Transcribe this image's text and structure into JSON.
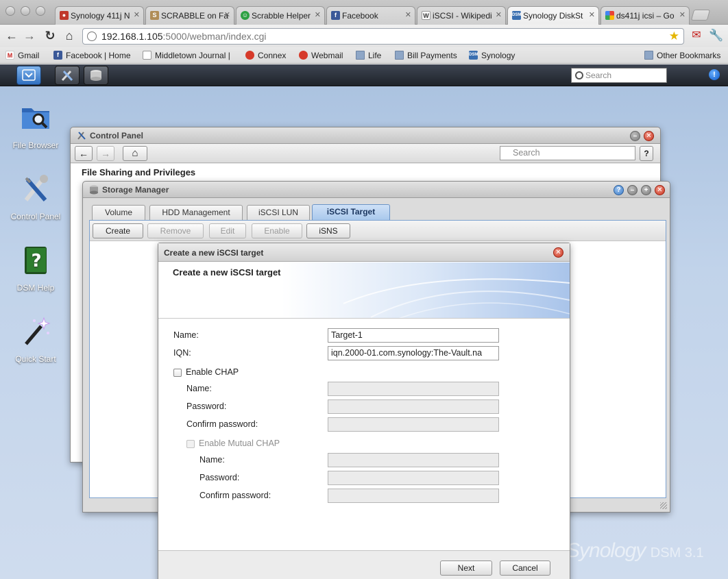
{
  "browser": {
    "tabs": [
      {
        "title": "Synology 411j N",
        "favicon": "apple-icon",
        "color": "#c0392b"
      },
      {
        "title": "SCRABBLE on Fa",
        "favicon": "scrabble-s-icon",
        "color": "#b08d57"
      },
      {
        "title": "Scrabble Helper",
        "favicon": "smiley-icon",
        "color": "#2ea043"
      },
      {
        "title": "Facebook",
        "favicon": "facebook-icon",
        "color": "#3b5998"
      },
      {
        "title": "iSCSI - Wikipedi",
        "favicon": "wikipedia-w-icon",
        "color": "#555555"
      },
      {
        "title": "Synology DiskSt",
        "favicon": "dsm-icon",
        "color": "#3a6fb0"
      },
      {
        "title": "ds411j icsi – Go",
        "favicon": "google-icon",
        "color": "#3b82f6"
      }
    ],
    "url_host": "192.168.1.105",
    "url_rest": ":5000/webman/index.cgi",
    "bookmarks": [
      {
        "label": "Gmail",
        "icon": "gmail-icon"
      },
      {
        "label": "Facebook | Home",
        "icon": "facebook-icon"
      },
      {
        "label": "Middletown Journal |",
        "icon": "page-icon"
      },
      {
        "label": "Connex",
        "icon": "connex-icon"
      },
      {
        "label": "Webmail",
        "icon": "webmail-icon"
      },
      {
        "label": "Life",
        "icon": "folder-icon"
      },
      {
        "label": "Bill Payments",
        "icon": "folder-icon"
      },
      {
        "label": "Synology",
        "icon": "dsm-icon"
      }
    ],
    "other_bookmarks": "Other Bookmarks"
  },
  "dsm": {
    "search_placeholder": "Search",
    "desktop_icons": [
      {
        "label": "File Browser",
        "icon": "file-browser-icon"
      },
      {
        "label": "Control Panel",
        "icon": "control-panel-icon"
      },
      {
        "label": "DSM Help",
        "icon": "help-book-icon"
      },
      {
        "label": "Quick Start",
        "icon": "magic-wand-icon"
      }
    ],
    "logo": "Synology",
    "logo_version": "DSM 3.1"
  },
  "control_panel": {
    "title": "Control Panel",
    "search_placeholder": "Search",
    "section_heading": "File Sharing and Privileges"
  },
  "storage_manager": {
    "title": "Storage Manager",
    "tabs": [
      "Volume",
      "HDD Management",
      "iSCSI LUN",
      "iSCSI Target"
    ],
    "active_tab": "iSCSI Target",
    "actions": {
      "create": "Create",
      "remove": "Remove",
      "edit": "Edit",
      "enable": "Enable",
      "isns": "iSNS"
    }
  },
  "wizard": {
    "title": "Create a new iSCSI target",
    "heading": "Create a new iSCSI target",
    "name_label": "Name:",
    "name_value": "Target-1",
    "iqn_label": "IQN:",
    "iqn_value": "iqn.2000-01.com.synology:The-Vault.na",
    "enable_chap": "Enable CHAP",
    "chap_name_label": "Name:",
    "chap_password_label": "Password:",
    "chap_confirm_label": "Confirm password:",
    "enable_mutual_chap": "Enable Mutual CHAP",
    "mutual_name_label": "Name:",
    "mutual_password_label": "Password:",
    "mutual_confirm_label": "Confirm password:",
    "next": "Next",
    "cancel": "Cancel"
  }
}
